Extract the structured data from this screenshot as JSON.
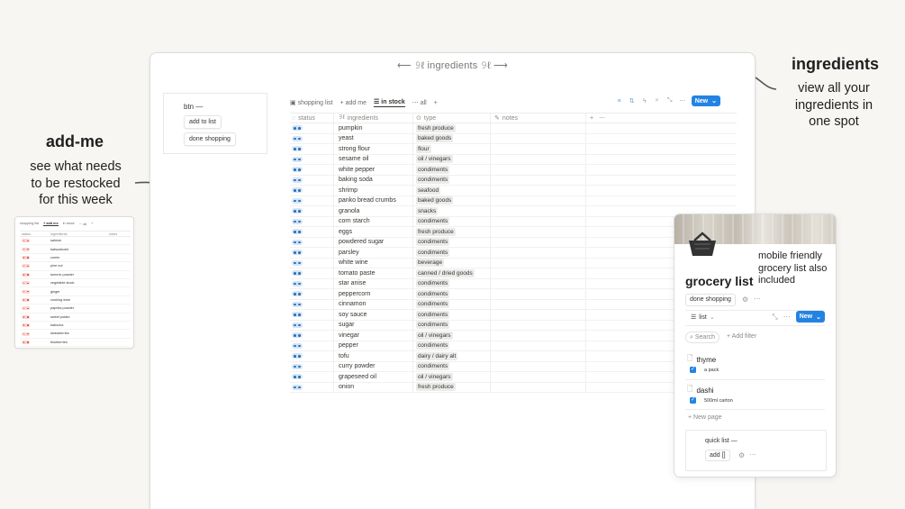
{
  "annotations": {
    "ingredients_title": "ingredients",
    "ingredients_text": [
      "view all your",
      "ingredients  in",
      "one spot"
    ],
    "addme_title": "add-me",
    "addme_text": [
      "see what needs",
      "to be restocked",
      "for this week"
    ]
  },
  "main": {
    "title": "⟵ 𝟿ℓ ingredients 𝟿ℓ ⟶",
    "button_block": {
      "label": "btn —",
      "buttons": [
        "add to list",
        "done shopping"
      ]
    },
    "tabs": [
      {
        "icon": "▣",
        "label": "shopping list"
      },
      {
        "icon": "+",
        "label": "add me"
      },
      {
        "icon": "☰",
        "label": "in stock",
        "active": true
      },
      {
        "icon": "⋯",
        "label": "all"
      },
      {
        "icon": "+",
        "label": ""
      }
    ],
    "new_button": "New",
    "columns": [
      "status",
      "ingredients",
      "type",
      "notes"
    ],
    "rows": [
      {
        "name": "pumpkin",
        "type": "fresh produce"
      },
      {
        "name": "yeast",
        "type": "baked goods"
      },
      {
        "name": "strong flour",
        "type": "flour"
      },
      {
        "name": "sesame oil",
        "type": "oil / vinegars"
      },
      {
        "name": "white pepper",
        "type": "condiments"
      },
      {
        "name": "baking soda",
        "type": "condiments"
      },
      {
        "name": "shrimp",
        "type": "seafood"
      },
      {
        "name": "panko bread crumbs",
        "type": "baked goods"
      },
      {
        "name": "granola",
        "type": "snacks"
      },
      {
        "name": "corn starch",
        "type": "condiments"
      },
      {
        "name": "eggs",
        "type": "fresh produce"
      },
      {
        "name": "powdered sugar",
        "type": "condiments"
      },
      {
        "name": "parsley",
        "type": "condiments"
      },
      {
        "name": "white wine",
        "type": "beverage"
      },
      {
        "name": "tomato paste",
        "type": "canned / dried goods"
      },
      {
        "name": "star anise",
        "type": "condiments"
      },
      {
        "name": "peppercorn",
        "type": "condiments"
      },
      {
        "name": "cinnamon",
        "type": "condiments"
      },
      {
        "name": "soy sauce",
        "type": "condiments"
      },
      {
        "name": "sugar",
        "type": "condiments"
      },
      {
        "name": "vinegar",
        "type": "oil / vinegars"
      },
      {
        "name": "pepper",
        "type": "condiments"
      },
      {
        "name": "tofu",
        "type": "dairy / dairy alt"
      },
      {
        "name": "curry powder",
        "type": "condiments"
      },
      {
        "name": "grapeseed oil",
        "type": "oil / vinegars"
      },
      {
        "name": "onion",
        "type": "fresh produce"
      }
    ],
    "status_color": "#2f6fb5"
  },
  "small": {
    "tabs": [
      "shopping list",
      "+ add me",
      "in stock",
      "⋯ all",
      "+"
    ],
    "columns": [
      "status",
      "ingredients",
      "notes"
    ],
    "rows": [
      "salmon",
      "katsuobushi",
      "cumin",
      "pine nut",
      "tumeric powder",
      "vegetable stock",
      "ginger",
      "cooking wine",
      "paprika powder",
      "sweet potato",
      "kabocha",
      "strawberries",
      "blueberries"
    ],
    "status_color": "#d44c47"
  },
  "phone": {
    "note": "mobile friendly grocery list also included",
    "title": "grocery list",
    "done_button": "done shopping",
    "view": "list",
    "new_button": "New",
    "search": "Search",
    "add_filter": "+ Add filter",
    "items": [
      {
        "name": "thyme",
        "sub": "a pack"
      },
      {
        "name": "dashi",
        "sub": "500ml carton"
      }
    ],
    "new_page": "+ New page",
    "quick_list": "quick list —",
    "add_button": "add []",
    "accent": "#2383e2"
  }
}
